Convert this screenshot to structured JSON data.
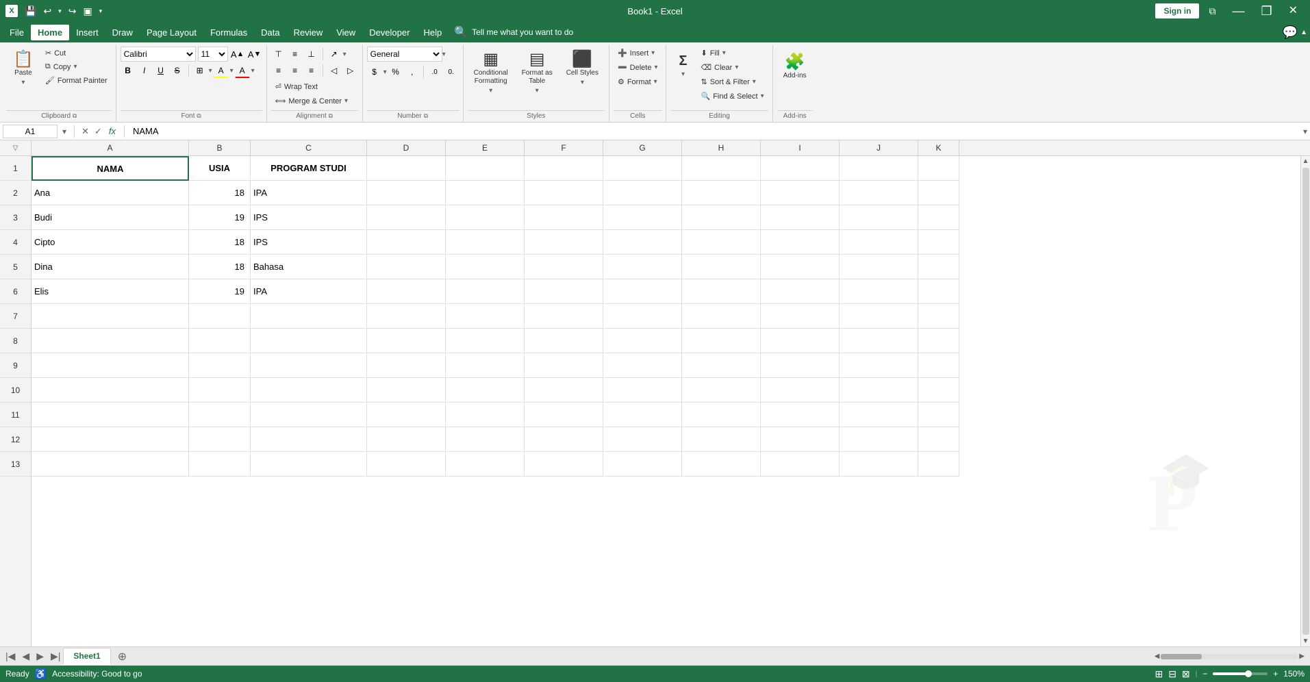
{
  "titleBar": {
    "appName": "Book1 - Excel",
    "signIn": "Sign in",
    "quickSave": "💾",
    "undo": "↩",
    "redo": "↪",
    "customize": "▾",
    "minimize": "—",
    "restore": "❐",
    "close": "✕"
  },
  "menuBar": {
    "items": [
      "File",
      "Home",
      "Insert",
      "Draw",
      "Page Layout",
      "Formulas",
      "Data",
      "Review",
      "View",
      "Developer",
      "Help"
    ]
  },
  "ribbon": {
    "groups": {
      "clipboard": {
        "label": "Clipboard",
        "paste": "Paste",
        "cut": "✂",
        "copy": "⧉",
        "formatPainter": "🖌"
      },
      "font": {
        "label": "Font",
        "fontName": "Calibri",
        "fontSize": "11",
        "grow": "A▲",
        "shrink": "A▼",
        "bold": "B",
        "italic": "I",
        "underline": "U",
        "borders": "⊞",
        "fillColor": "A",
        "fontColor": "A"
      },
      "alignment": {
        "label": "Alignment",
        "topAlign": "⊤",
        "middleAlign": "≡",
        "bottomAlign": "⊥",
        "leftAlign": "≡",
        "centerAlign": "≡",
        "rightAlign": "≡",
        "decreaseIndent": "◁",
        "increaseIndent": "▷",
        "wrapText": "Wrap Text",
        "mergeCenter": "Merge & Center",
        "orientation": "↗"
      },
      "number": {
        "label": "Number",
        "format": "General",
        "currency": "$",
        "percent": "%",
        "comma": ",",
        "decreaseDecimal": "←0",
        "increaseDecimal": "0→"
      },
      "styles": {
        "label": "Styles",
        "conditional": "Conditional\nFormatting",
        "formatTable": "Format as\nTable",
        "cellStyles": "Cell Styles"
      },
      "cells": {
        "label": "Cells",
        "insert": "Insert",
        "delete": "Delete",
        "format": "Format"
      },
      "editing": {
        "label": "Editing",
        "autoSum": "Σ",
        "fill": "⬇",
        "clear": "⌫",
        "sortFilter": "Sort &\nFilter",
        "findSelect": "Find &\nSelect"
      },
      "addins": {
        "label": "Add-ins",
        "addins": "Add-ins"
      }
    }
  },
  "formulaBar": {
    "cellRef": "A1",
    "cancelSymbol": "✕",
    "confirmSymbol": "✓",
    "functionSymbol": "fx",
    "formula": "NAMA"
  },
  "columns": [
    "A",
    "B",
    "C",
    "D",
    "E",
    "F",
    "G",
    "H",
    "I",
    "J",
    "K"
  ],
  "rows": [
    1,
    2,
    3,
    4,
    5,
    6,
    7,
    8,
    9,
    10,
    11,
    12,
    13
  ],
  "cells": {
    "A1": {
      "value": "NAMA",
      "bold": true,
      "align": "center"
    },
    "B1": {
      "value": "USIA",
      "bold": true,
      "align": "center"
    },
    "C1": {
      "value": "PROGRAM STUDI",
      "bold": true,
      "align": "center"
    },
    "A2": {
      "value": "Ana"
    },
    "B2": {
      "value": "18",
      "align": "right"
    },
    "C2": {
      "value": "IPA"
    },
    "A3": {
      "value": "Budi"
    },
    "B3": {
      "value": "19",
      "align": "right"
    },
    "C3": {
      "value": "IPS"
    },
    "A4": {
      "value": "Cipto"
    },
    "B4": {
      "value": "18",
      "align": "right"
    },
    "C4": {
      "value": "IPS"
    },
    "A5": {
      "value": "Dina"
    },
    "B5": {
      "value": "18",
      "align": "right"
    },
    "C5": {
      "value": "Bahasa"
    },
    "A6": {
      "value": "Elis"
    },
    "B6": {
      "value": "19",
      "align": "right"
    },
    "C6": {
      "value": "IPA"
    }
  },
  "activeCell": "A1",
  "sheets": [
    {
      "name": "Sheet1",
      "active": true
    }
  ],
  "statusBar": {
    "ready": "Ready",
    "accessibility": "Accessibility: Good to go",
    "zoom": "150%",
    "viewNormal": "⊞",
    "viewLayout": "⊟",
    "viewPage": "⊠"
  },
  "colors": {
    "excelGreen": "#217346",
    "ribbonBg": "#f3f3f3",
    "headerBg": "#f3f3f3",
    "selectedCell": "#217346",
    "gridLine": "#e0e0e0"
  }
}
